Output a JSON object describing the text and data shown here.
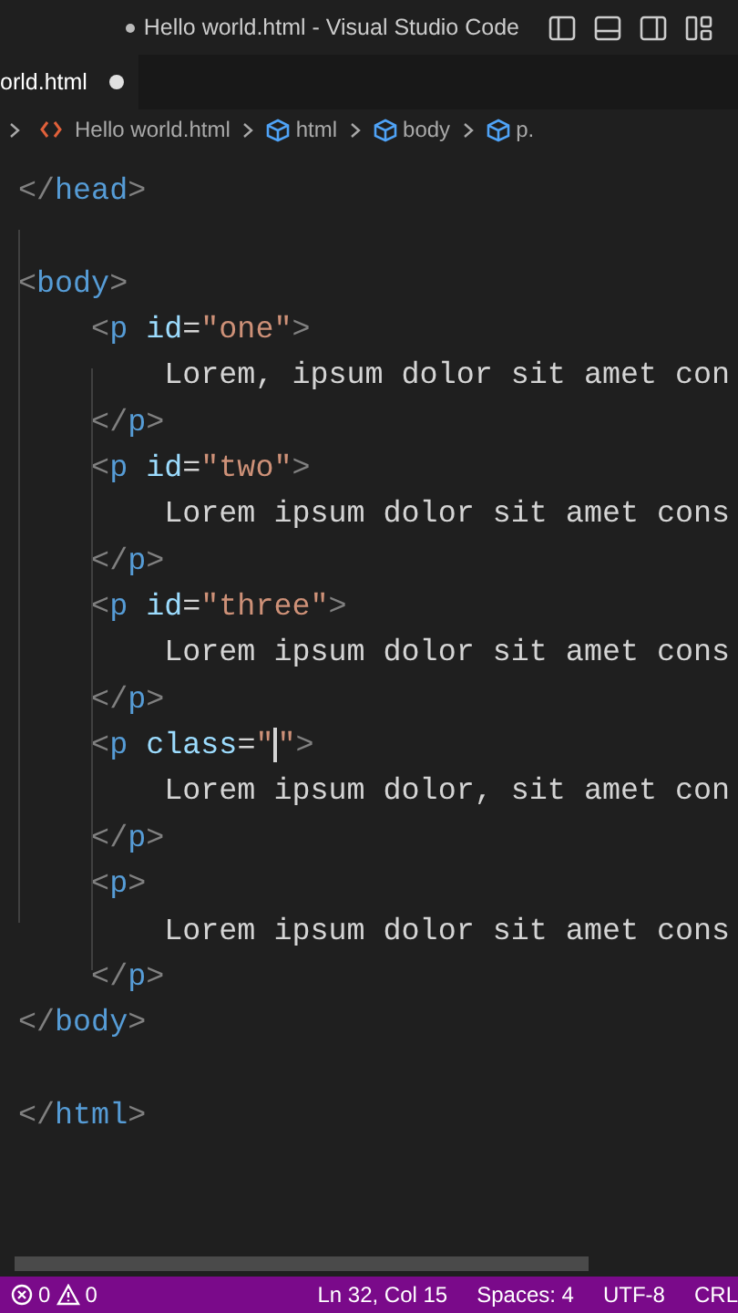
{
  "window": {
    "title": "Hello world.html - Visual Studio Code",
    "modified": true
  },
  "tabs": [
    {
      "label": "orld.html",
      "selected": true,
      "modified": true
    }
  ],
  "breadcrumbs": [
    {
      "kind": "file",
      "label": "Hello world.html"
    },
    {
      "kind": "element",
      "label": "html"
    },
    {
      "kind": "element",
      "label": "body"
    },
    {
      "kind": "element",
      "label": "p."
    }
  ],
  "editor": {
    "lines": [
      {
        "kind": "code",
        "tokens": [
          {
            "kind": "punct",
            "text": "</"
          },
          {
            "kind": "tag",
            "text": "head"
          },
          {
            "kind": "punct",
            "text": ">"
          }
        ]
      },
      {
        "kind": "blank"
      },
      {
        "kind": "code",
        "tokens": [
          {
            "kind": "punct",
            "text": "<"
          },
          {
            "kind": "tag",
            "text": "body"
          },
          {
            "kind": "punct",
            "text": ">"
          }
        ]
      },
      {
        "kind": "code",
        "tokens": [
          {
            "kind": "punct",
            "text": "    <"
          },
          {
            "kind": "tag",
            "text": "p"
          },
          {
            "kind": "attr",
            "text": " id"
          },
          {
            "kind": "plain",
            "text": "="
          },
          {
            "kind": "string",
            "text": "\"one\""
          },
          {
            "kind": "punct",
            "text": ">"
          }
        ]
      },
      {
        "kind": "code",
        "tokens": [
          {
            "kind": "plain",
            "text": "        Lorem, ipsum dolor sit amet con"
          }
        ]
      },
      {
        "kind": "code",
        "tokens": [
          {
            "kind": "punct",
            "text": "    </"
          },
          {
            "kind": "tag",
            "text": "p"
          },
          {
            "kind": "punct",
            "text": ">"
          }
        ]
      },
      {
        "kind": "code",
        "tokens": [
          {
            "kind": "punct",
            "text": "    <"
          },
          {
            "kind": "tag",
            "text": "p"
          },
          {
            "kind": "attr",
            "text": " id"
          },
          {
            "kind": "plain",
            "text": "="
          },
          {
            "kind": "string",
            "text": "\"two\""
          },
          {
            "kind": "punct",
            "text": ">"
          }
        ]
      },
      {
        "kind": "code",
        "tokens": [
          {
            "kind": "plain",
            "text": "        Lorem ipsum dolor sit amet cons"
          }
        ]
      },
      {
        "kind": "code",
        "tokens": [
          {
            "kind": "punct",
            "text": "    </"
          },
          {
            "kind": "tag",
            "text": "p"
          },
          {
            "kind": "punct",
            "text": ">"
          }
        ]
      },
      {
        "kind": "code",
        "tokens": [
          {
            "kind": "punct",
            "text": "    <"
          },
          {
            "kind": "tag",
            "text": "p"
          },
          {
            "kind": "attr",
            "text": " id"
          },
          {
            "kind": "plain",
            "text": "="
          },
          {
            "kind": "string",
            "text": "\"three\""
          },
          {
            "kind": "punct",
            "text": ">"
          }
        ]
      },
      {
        "kind": "code",
        "tokens": [
          {
            "kind": "plain",
            "text": "        Lorem ipsum dolor sit amet cons"
          }
        ]
      },
      {
        "kind": "code",
        "tokens": [
          {
            "kind": "punct",
            "text": "    </"
          },
          {
            "kind": "tag",
            "text": "p"
          },
          {
            "kind": "punct",
            "text": ">"
          }
        ]
      },
      {
        "kind": "code",
        "tokens": [
          {
            "kind": "punct",
            "text": "    <"
          },
          {
            "kind": "tag",
            "text": "p"
          },
          {
            "kind": "attr",
            "text": " class"
          },
          {
            "kind": "plain",
            "text": "="
          },
          {
            "kind": "string",
            "text": "\""
          },
          {
            "kind": "caret"
          },
          {
            "kind": "string",
            "text": "\""
          },
          {
            "kind": "punct",
            "text": ">"
          }
        ]
      },
      {
        "kind": "code",
        "tokens": [
          {
            "kind": "plain",
            "text": "        Lorem ipsum dolor, sit amet con"
          }
        ]
      },
      {
        "kind": "code",
        "tokens": [
          {
            "kind": "punct",
            "text": "    </"
          },
          {
            "kind": "tag",
            "text": "p"
          },
          {
            "kind": "punct",
            "text": ">"
          }
        ]
      },
      {
        "kind": "code",
        "tokens": [
          {
            "kind": "punct",
            "text": "    <"
          },
          {
            "kind": "tag",
            "text": "p"
          },
          {
            "kind": "punct",
            "text": ">"
          }
        ]
      },
      {
        "kind": "code",
        "tokens": [
          {
            "kind": "plain",
            "text": "        Lorem ipsum dolor sit amet cons"
          }
        ]
      },
      {
        "kind": "code",
        "tokens": [
          {
            "kind": "punct",
            "text": "    </"
          },
          {
            "kind": "tag",
            "text": "p"
          },
          {
            "kind": "punct",
            "text": ">"
          }
        ]
      },
      {
        "kind": "code",
        "tokens": [
          {
            "kind": "punct",
            "text": "</"
          },
          {
            "kind": "tag",
            "text": "body"
          },
          {
            "kind": "punct",
            "text": ">"
          }
        ]
      },
      {
        "kind": "blank"
      },
      {
        "kind": "code",
        "tokens": [
          {
            "kind": "punct",
            "text": "</"
          },
          {
            "kind": "tag",
            "text": "html"
          },
          {
            "kind": "punct",
            "text": ">"
          }
        ]
      }
    ]
  },
  "status_bar": {
    "errors": "0",
    "warnings": "0",
    "items": [
      "Ln 32, Col 15",
      "Spaces: 4",
      "UTF-8",
      "CRL"
    ]
  }
}
